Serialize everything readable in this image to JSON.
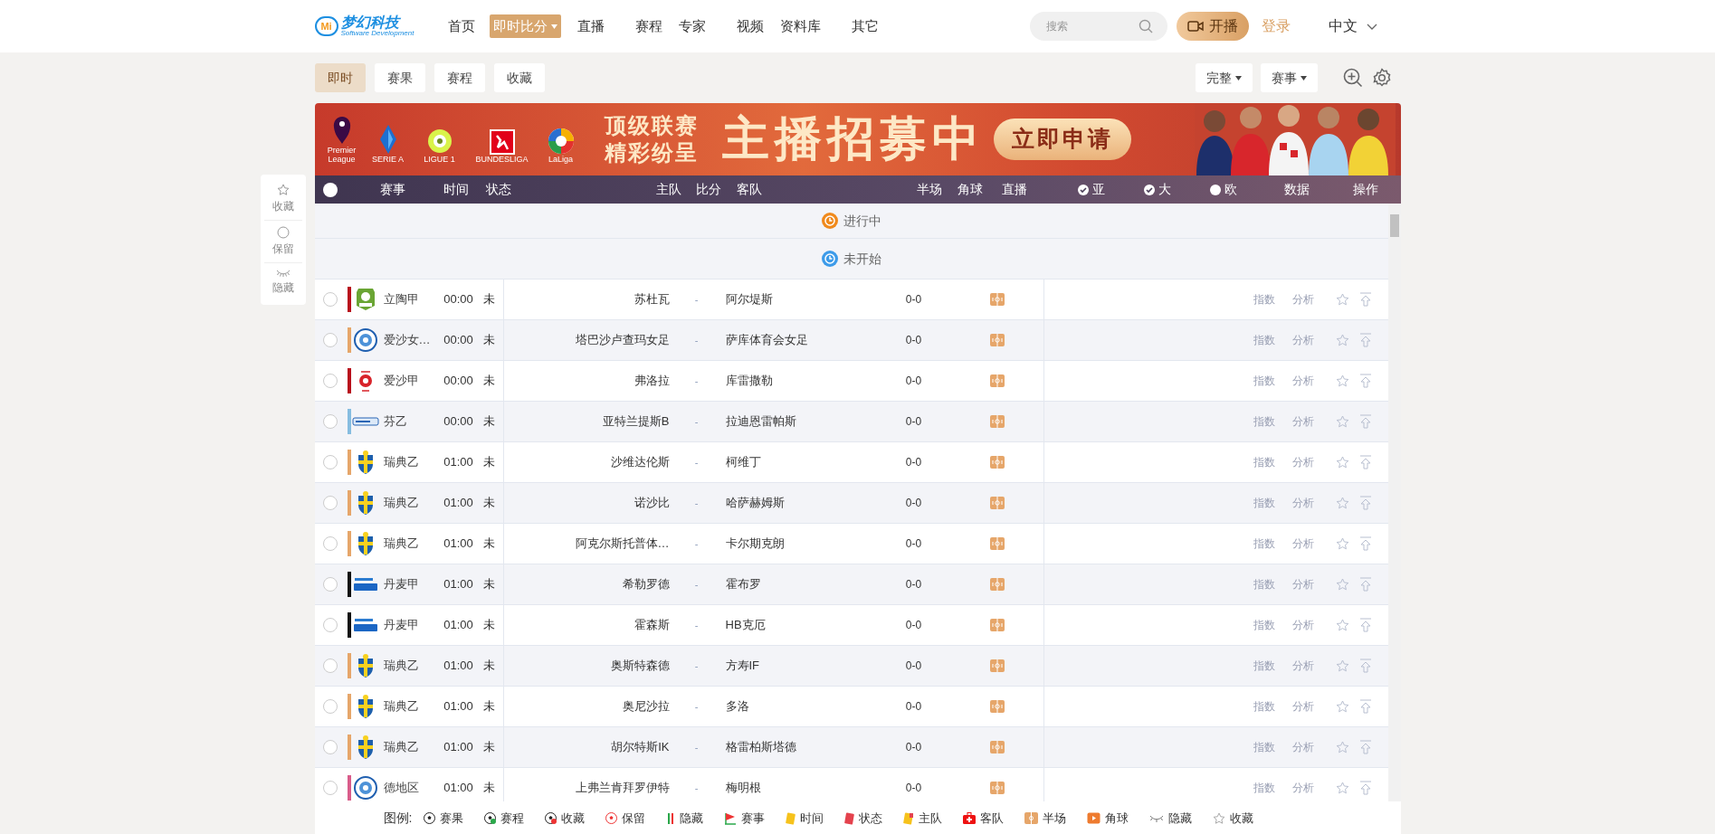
{
  "header": {
    "logo": {
      "mark": "Mi",
      "name": "梦幻科技",
      "tagline": "Software Development"
    },
    "nav": [
      {
        "label": "首页",
        "selected": false,
        "dropdown": false
      },
      {
        "label": "即时比分",
        "selected": true,
        "dropdown": true
      },
      {
        "label": "直播",
        "selected": false,
        "dropdown": false
      },
      {
        "label": "赛程",
        "selected": false,
        "dropdown": false
      },
      {
        "label": "专家",
        "selected": false,
        "dropdown": false
      },
      {
        "label": "视频",
        "selected": false,
        "dropdown": false
      },
      {
        "label": "资料库",
        "selected": false,
        "dropdown": false
      },
      {
        "label": "其它",
        "selected": false,
        "dropdown": false
      }
    ],
    "search": {
      "placeholder": "搜索"
    },
    "broadcast_button": "开播",
    "login": "登录",
    "language": "中文"
  },
  "tabs": [
    {
      "label": "即时",
      "selected": true
    },
    {
      "label": "赛果",
      "selected": false
    },
    {
      "label": "赛程",
      "selected": false
    },
    {
      "label": "收藏",
      "selected": false
    }
  ],
  "filters": [
    "完整",
    "赛事"
  ],
  "banner": {
    "leagues": [
      "Premier League",
      "SERIE A",
      "LIGUE 1",
      "BUNDESLIGA",
      "LaLiga"
    ],
    "slogan": [
      "顶级联赛",
      "精彩纷呈"
    ],
    "headline": "主播招募中",
    "cta": "立即申请"
  },
  "side_panel": [
    {
      "kind": "star",
      "label": "收藏"
    },
    {
      "kind": "circle",
      "label": "保留"
    },
    {
      "kind": "eye",
      "label": "隐藏"
    }
  ],
  "table": {
    "select_all": {
      "selected": false
    },
    "columns": [
      {
        "label": "赛事"
      },
      {
        "label": "时间"
      },
      {
        "label": "状态"
      },
      {
        "label": "主队"
      },
      {
        "label": "比分"
      },
      {
        "label": "客队"
      },
      {
        "label": "半场"
      },
      {
        "label": "角球"
      },
      {
        "label": "直播"
      },
      {
        "label": "亚",
        "checked": true
      },
      {
        "label": "大",
        "checked": true
      },
      {
        "label": "欧",
        "checked": false
      },
      {
        "label": "数据"
      },
      {
        "label": "操作"
      }
    ],
    "sections": [
      {
        "label": "进行中",
        "color": "#f08a1c"
      },
      {
        "label": "未开始",
        "color": "#3d9be9"
      }
    ],
    "rows": [
      {
        "selected": false,
        "league": "立陶甲",
        "color": "#b8101c",
        "kind": "lyga",
        "time": "00:00",
        "status": "未",
        "home": "苏杜瓦",
        "score": "-",
        "away": "阿尔堤斯",
        "half": "0-0",
        "links": [
          "指数",
          "分析"
        ]
      },
      {
        "selected": false,
        "league": "爱沙女…",
        "color": "#e6a66a",
        "kind": "round",
        "time": "00:00",
        "status": "未",
        "home": "塔巴沙卢查玛女足",
        "score": "-",
        "away": "萨库体育会女足",
        "half": "0-0",
        "links": [
          "指数",
          "分析"
        ]
      },
      {
        "selected": false,
        "league": "爱沙甲",
        "color": "#b8101c",
        "kind": "flower",
        "time": "00:00",
        "status": "未",
        "home": "弗洛拉",
        "score": "-",
        "away": "库雷撒勒",
        "half": "0-0",
        "links": [
          "指数",
          "分析"
        ]
      },
      {
        "selected": false,
        "league": "芬乙",
        "color": "#86bde0",
        "kind": "banner",
        "time": "00:00",
        "status": "未",
        "home": "亚特兰提斯B",
        "score": "-",
        "away": "拉迪恩雷帕斯",
        "half": "0-0",
        "links": [
          "指数",
          "分析"
        ]
      },
      {
        "selected": false,
        "league": "瑞典乙",
        "color": "#e6a66a",
        "kind": "shield",
        "time": "01:00",
        "status": "未",
        "home": "沙维达伦斯",
        "score": "-",
        "away": "柯维丁",
        "half": "0-0",
        "links": [
          "指数",
          "分析"
        ]
      },
      {
        "selected": false,
        "league": "瑞典乙",
        "color": "#e6a66a",
        "kind": "shield",
        "time": "01:00",
        "status": "未",
        "home": "诺沙比",
        "score": "-",
        "away": "哈萨赫姆斯",
        "half": "0-0",
        "links": [
          "指数",
          "分析"
        ]
      },
      {
        "selected": false,
        "league": "瑞典乙",
        "color": "#e6a66a",
        "kind": "shield",
        "time": "01:00",
        "status": "未",
        "home": "阿克尔斯托普体…",
        "score": "-",
        "away": "卡尔期克朗",
        "half": "0-0",
        "links": [
          "指数",
          "分析"
        ]
      },
      {
        "selected": false,
        "league": "丹麦甲",
        "color": "#111111",
        "kind": "liga",
        "time": "01:00",
        "status": "未",
        "home": "希勒罗德",
        "score": "-",
        "away": "霍布罗",
        "half": "0-0",
        "links": [
          "指数",
          "分析"
        ]
      },
      {
        "selected": false,
        "league": "丹麦甲",
        "color": "#111111",
        "kind": "liga",
        "time": "01:00",
        "status": "未",
        "home": "霍森斯",
        "score": "-",
        "away": "HB克厄",
        "half": "0-0",
        "links": [
          "指数",
          "分析"
        ]
      },
      {
        "selected": false,
        "league": "瑞典乙",
        "color": "#e6a66a",
        "kind": "shield",
        "time": "01:00",
        "status": "未",
        "home": "奥斯特森德",
        "score": "-",
        "away": "方寿IF",
        "half": "0-0",
        "links": [
          "指数",
          "分析"
        ]
      },
      {
        "selected": false,
        "league": "瑞典乙",
        "color": "#e6a66a",
        "kind": "shield",
        "time": "01:00",
        "status": "未",
        "home": "奥尼沙拉",
        "score": "-",
        "away": "多洛",
        "half": "0-0",
        "links": [
          "指数",
          "分析"
        ]
      },
      {
        "selected": false,
        "league": "瑞典乙",
        "color": "#e6a66a",
        "kind": "shield",
        "time": "01:00",
        "status": "未",
        "home": "胡尔特斯IK",
        "score": "-",
        "away": "格雷柏斯塔德",
        "half": "0-0",
        "links": [
          "指数",
          "分析"
        ]
      },
      {
        "selected": false,
        "league": "德地区",
        "color": "#d95c8a",
        "kind": "round",
        "time": "01:00",
        "status": "未",
        "home": "上弗兰肯拜罗伊特",
        "score": "-",
        "away": "梅明根",
        "half": "0-0",
        "links": [
          "指数",
          "分析"
        ]
      }
    ]
  },
  "legend": {
    "label": "图例:",
    "items": [
      {
        "kind": "ball",
        "label": "赛果"
      },
      {
        "kind": "ball-green",
        "label": "赛程"
      },
      {
        "kind": "ball-x",
        "label": "收藏"
      },
      {
        "kind": "ball-red",
        "label": "保留"
      },
      {
        "kind": "bars",
        "label": "隐藏"
      },
      {
        "kind": "flag",
        "label": "赛事"
      },
      {
        "kind": "card-yellow",
        "label": "时间"
      },
      {
        "kind": "card-red",
        "label": "状态"
      },
      {
        "kind": "card-swap",
        "label": "主队"
      },
      {
        "kind": "medkit",
        "label": "客队"
      },
      {
        "kind": "pitch",
        "label": "半场"
      },
      {
        "kind": "video",
        "label": "角球"
      },
      {
        "kind": "eye",
        "label": "隐藏"
      },
      {
        "kind": "star",
        "label": "收藏"
      }
    ]
  }
}
